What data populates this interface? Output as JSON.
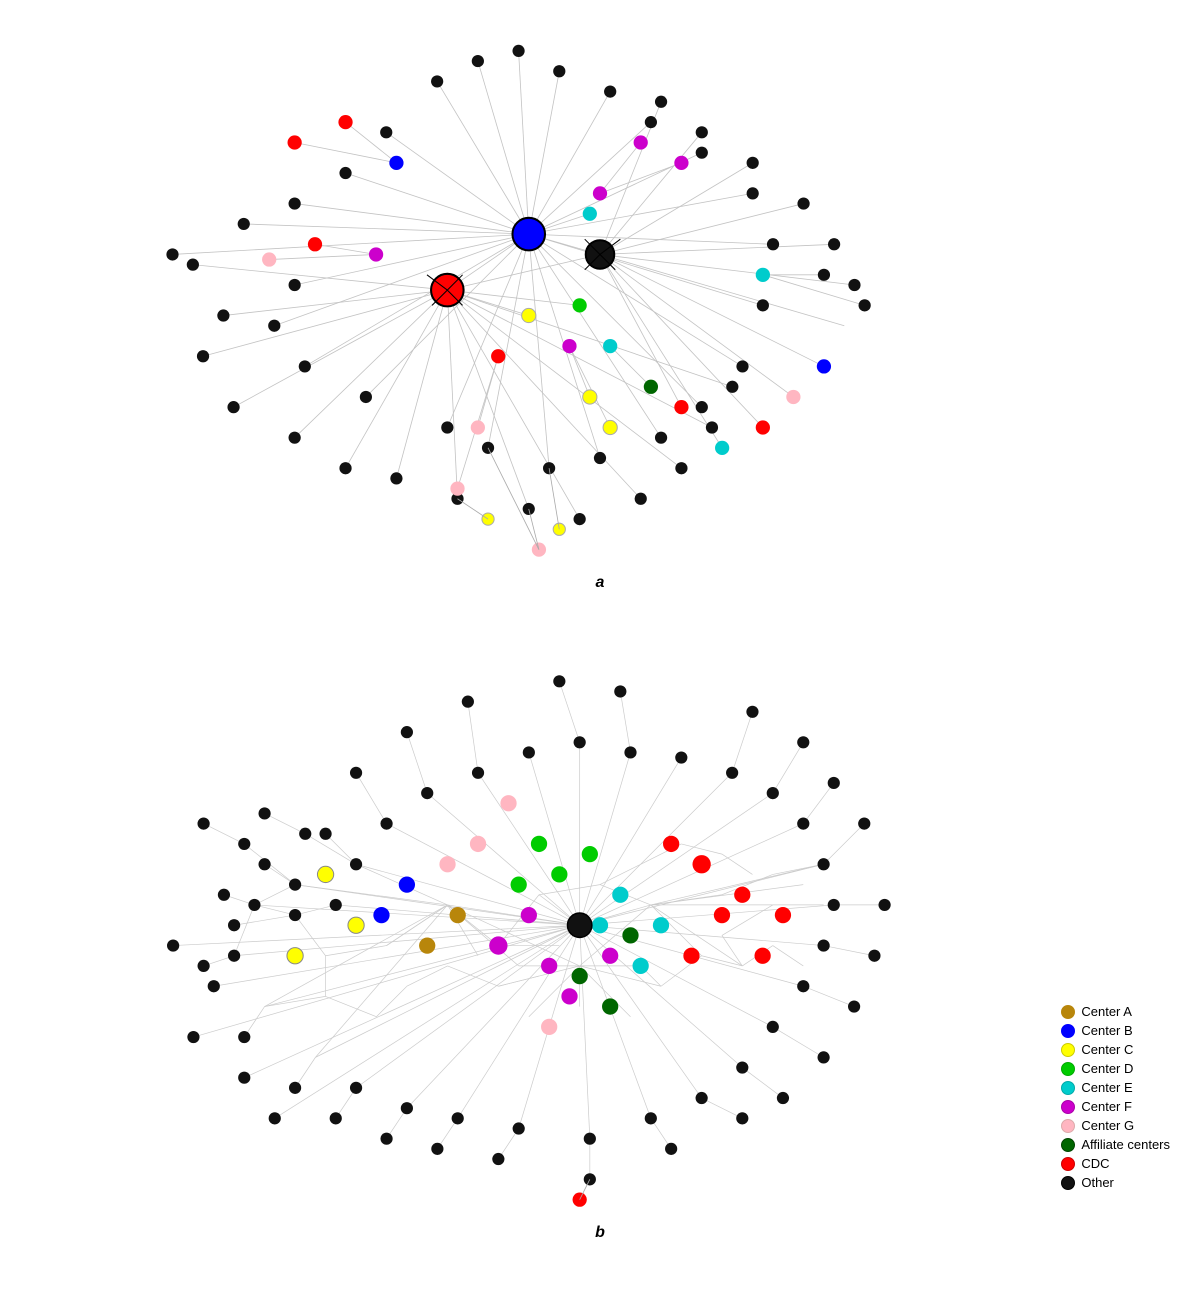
{
  "sections": [
    {
      "id": "a",
      "label": "a"
    },
    {
      "id": "b",
      "label": "b"
    }
  ],
  "legend": {
    "items": [
      {
        "label": "Center A",
        "color": "#b8860b"
      },
      {
        "label": "Center B",
        "color": "#0000ff"
      },
      {
        "label": "Center C",
        "color": "#ffff00"
      },
      {
        "label": "Center D",
        "color": "#00cc00"
      },
      {
        "label": "Center E",
        "color": "#00cccc"
      },
      {
        "label": "Center F",
        "color": "#cc00cc"
      },
      {
        "label": "Center G",
        "color": "#ffb6c1"
      },
      {
        "label": "Affiliate centers",
        "color": "#006600"
      },
      {
        "label": "CDC",
        "color": "#ff0000"
      },
      {
        "label": "Other",
        "color": "#000000"
      }
    ]
  }
}
